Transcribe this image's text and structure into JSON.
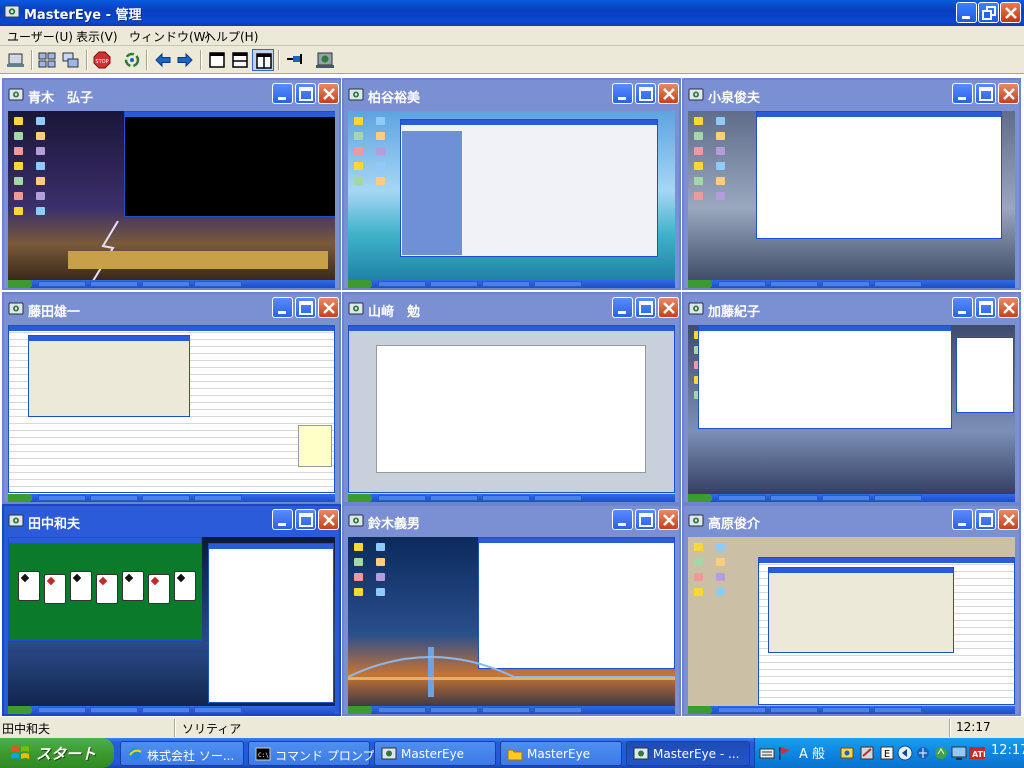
{
  "window": {
    "title": "MasterEye - 管理"
  },
  "menu": [
    "ユーザー(U)",
    "表示(V)",
    "ウィンドウ(W)",
    "ヘルプ(H)"
  ],
  "toolbar": {
    "tools": [
      "user-add",
      "tile-a",
      "tile-b",
      "stop",
      "refresh",
      "back",
      "forward",
      "layout-1",
      "layout-2",
      "layout-3",
      "pin",
      "settings"
    ],
    "active": "layout-3"
  },
  "panes": [
    {
      "name": "青木　弘子",
      "desktop": "lightning"
    },
    {
      "name": "柏谷裕美",
      "desktop": "beach"
    },
    {
      "name": "小泉俊夫",
      "desktop": "ship"
    },
    {
      "name": "藤田雄一",
      "desktop": "excel"
    },
    {
      "name": "山﨑　勉",
      "desktop": "word"
    },
    {
      "name": "加藤紀子",
      "desktop": "notepad"
    },
    {
      "name": "田中和夫",
      "desktop": "solitaire",
      "selected": true
    },
    {
      "name": "鈴木義男",
      "desktop": "bridge"
    },
    {
      "name": "高原俊介",
      "desktop": "chart-dialog"
    }
  ],
  "status": {
    "user": "田中和夫",
    "app": "ソリティア",
    "time": "12:17"
  },
  "taskbar": {
    "start": "スタート",
    "tasks": [
      {
        "label": "株式会社 ソー...",
        "icon": "ie"
      },
      {
        "label": "コマンド プロンプ...",
        "icon": "cmd"
      },
      {
        "label": "MasterEye",
        "icon": "eye"
      },
      {
        "label": "MasterEye",
        "icon": "folder"
      },
      {
        "label": "MasterEye - ...",
        "icon": "eye",
        "active": true
      }
    ],
    "tray": {
      "ime": "A 般",
      "clock": "12:17"
    }
  },
  "colors": {
    "xp_blue": "#0a3fbf",
    "pane": "#7b8fd3",
    "pane_selected": "#2b5bd8",
    "close": "#c8401a"
  }
}
